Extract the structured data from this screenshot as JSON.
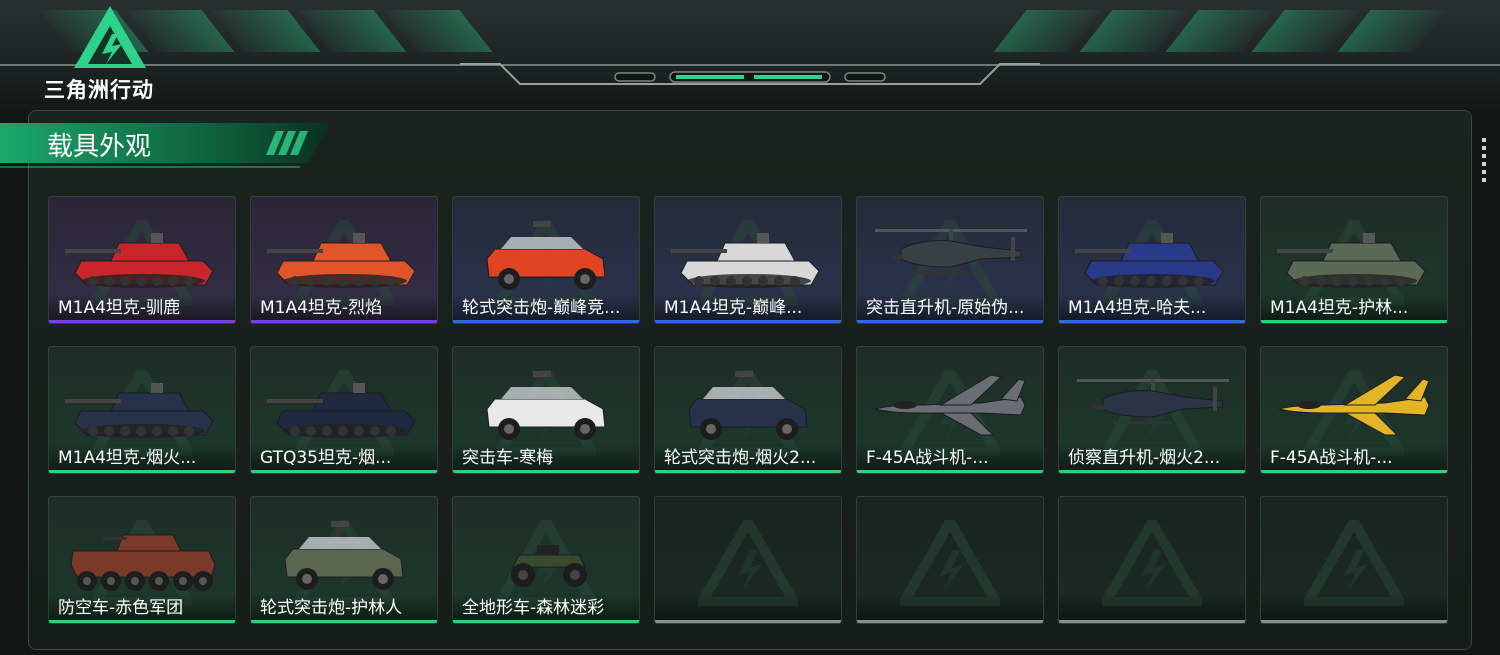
{
  "logo": {
    "text": "三角洲行动"
  },
  "section": {
    "title": "载具外观"
  },
  "colors": {
    "accent": "#2fd28a",
    "rarity_purple": "#7b3fe0",
    "rarity_blue": "#3169e0",
    "rarity_green": "#2fcf7e",
    "rarity_empty": "#8a8f8c"
  },
  "items": [
    {
      "name": "M1A4坦克-驯鹿",
      "rarity": "purple",
      "vehicle": "tank",
      "color": "#c8262a"
    },
    {
      "name": "M1A4坦克-烈焰",
      "rarity": "purple",
      "vehicle": "tank",
      "color": "#e0552a"
    },
    {
      "name": "轮式突击炮-巅峰竞...",
      "rarity": "blue",
      "vehicle": "truck",
      "color": "#e04422"
    },
    {
      "name": "M1A4坦克-巅峰...",
      "rarity": "blue",
      "vehicle": "tank",
      "color": "#d8d8d8"
    },
    {
      "name": "突击直升机-原始伪...",
      "rarity": "blue",
      "vehicle": "heli",
      "color": "#3a3f44"
    },
    {
      "name": "M1A4坦克-哈夫...",
      "rarity": "blue",
      "vehicle": "tank",
      "color": "#2a3a8a"
    },
    {
      "name": "M1A4坦克-护林...",
      "rarity": "green",
      "vehicle": "tank",
      "color": "#5a6a55"
    },
    {
      "name": "M1A4坦克-烟火...",
      "rarity": "green",
      "vehicle": "tank",
      "color": "#25324a"
    },
    {
      "name": "GTQ35坦克-烟...",
      "rarity": "green",
      "vehicle": "tank",
      "color": "#1f2a40"
    },
    {
      "name": "突击车-寒梅",
      "rarity": "green",
      "vehicle": "truck",
      "color": "#e8e8e8"
    },
    {
      "name": "轮式突击炮-烟火2...",
      "rarity": "green",
      "vehicle": "truck",
      "color": "#26324a"
    },
    {
      "name": "F-45A战斗机-...",
      "rarity": "green",
      "vehicle": "jet",
      "color": "#6a6e74"
    },
    {
      "name": "侦察直升机-烟火2...",
      "rarity": "green",
      "vehicle": "heli",
      "color": "#2a3446"
    },
    {
      "name": "F-45A战斗机-...",
      "rarity": "green",
      "vehicle": "jet",
      "color": "#e2b526"
    },
    {
      "name": "防空车-赤色军团",
      "rarity": "green",
      "vehicle": "apc",
      "color": "#7a3a2a"
    },
    {
      "name": "轮式突击炮-护林人",
      "rarity": "green",
      "vehicle": "truck",
      "color": "#5a6650"
    },
    {
      "name": "全地形车-森林迷彩",
      "rarity": "green",
      "vehicle": "atv",
      "color": "#3a4a2e"
    },
    {
      "name": "",
      "rarity": "empty",
      "vehicle": "",
      "color": ""
    },
    {
      "name": "",
      "rarity": "empty",
      "vehicle": "",
      "color": ""
    },
    {
      "name": "",
      "rarity": "empty",
      "vehicle": "",
      "color": ""
    },
    {
      "name": "",
      "rarity": "empty",
      "vehicle": "",
      "color": ""
    }
  ]
}
